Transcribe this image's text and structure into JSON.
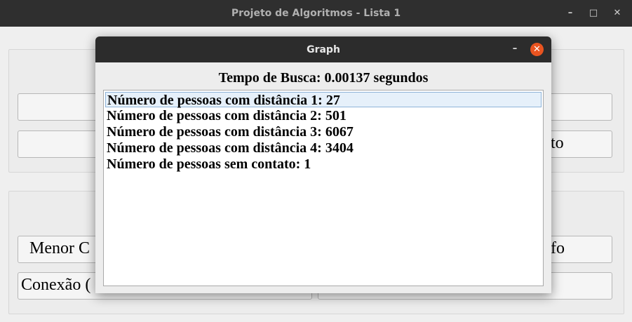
{
  "main_window": {
    "title": "Projeto de Algoritmos - Lista 1",
    "controls": {
      "minimize": "–",
      "maximize": "□",
      "close": "✕"
    },
    "buttons_partial": {
      "group2_left_top": "Menor C",
      "group2_right_top": "fo",
      "group2_left_bottom": "Conexão (",
      "group1_right_bottom": "to"
    }
  },
  "dialog": {
    "title": "Graph",
    "minimize": "–",
    "close": "✕",
    "search_time": "Tempo de Busca: 0.00137 segundos",
    "items": [
      "Número de pessoas com distância 1: 27",
      "Número de pessoas com distância 2: 501",
      "Número de pessoas com distância 3: 6067",
      "Número de pessoas com distância 4: 3404",
      "Número de pessoas sem contato: 1"
    ]
  }
}
